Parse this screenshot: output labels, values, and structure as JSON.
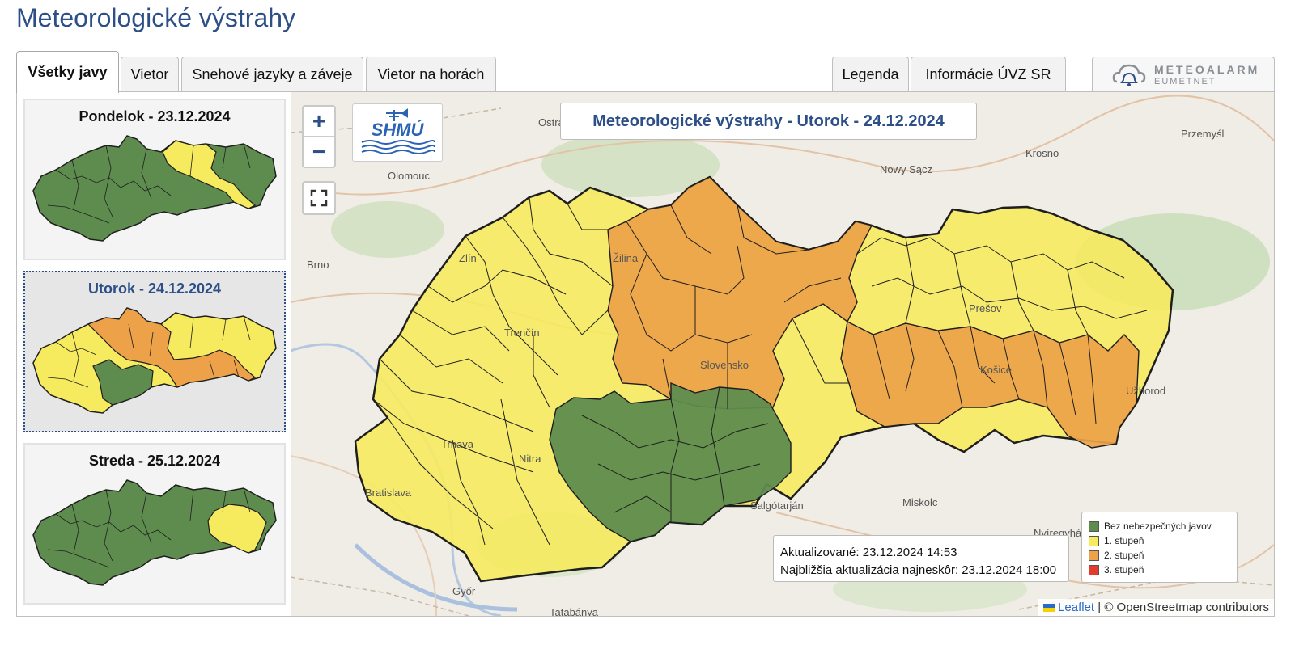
{
  "page": {
    "title": "Meteorologické výstrahy"
  },
  "tabs": [
    {
      "label": "Všetky javy",
      "active": true
    },
    {
      "label": "Vietor"
    },
    {
      "label": "Snehové jazyky a záveje"
    },
    {
      "label": "Vietor na horách"
    }
  ],
  "tabs_right": [
    {
      "label": "Legenda"
    },
    {
      "label": "Informácie ÚVZ SR"
    }
  ],
  "meteoalarm": {
    "name": "METEOALARM",
    "sub": "EUMETNET"
  },
  "days": [
    {
      "title": "Pondelok - 23.12.2024",
      "selected": false
    },
    {
      "title": "Utorok - 24.12.2024",
      "selected": true
    },
    {
      "title": "Streda - 25.12.2024",
      "selected": false
    }
  ],
  "map": {
    "title": "Meteorologické výstrahy - Utorok - 24.12.2024",
    "zoom_in": "+",
    "zoom_out": "−",
    "logo_text": "SHMÚ",
    "updated": "Aktualizované: 23.12.2024 14:53",
    "next_update": "Najbližšia aktualizácia najneskôr: 23.12.2024 18:00",
    "attribution_leaflet": "Leaflet",
    "attribution_rest": " | © OpenStreetmap contributors",
    "cities": [
      "Ostrava",
      "Olomouc",
      "Nowy Sącz",
      "Krosno",
      "Przemyśl",
      "Brno",
      "Zlín",
      "Žilina",
      "Trenčín",
      "Prešov",
      "Slovensko",
      "Košice",
      "Užhorod",
      "Trnava",
      "Nitra",
      "Bratislava",
      "Salgótarján",
      "Miskolc",
      "Nyíregyháza",
      "Győr",
      "Tatabánya"
    ]
  },
  "legend": [
    {
      "label": "Bez nebezpečných javov",
      "color": "#5e8c4e"
    },
    {
      "label": "1. stupeň",
      "color": "#f6ea5f"
    },
    {
      "label": "2. stupeň",
      "color": "#eda24a"
    },
    {
      "label": "3. stupeň",
      "color": "#e53b2e"
    }
  ],
  "colors": {
    "green": "#5e8c4e",
    "yellow": "#f6ea5f",
    "orange": "#eda24a",
    "red": "#e53b2e",
    "brand": "#2d4f87"
  }
}
